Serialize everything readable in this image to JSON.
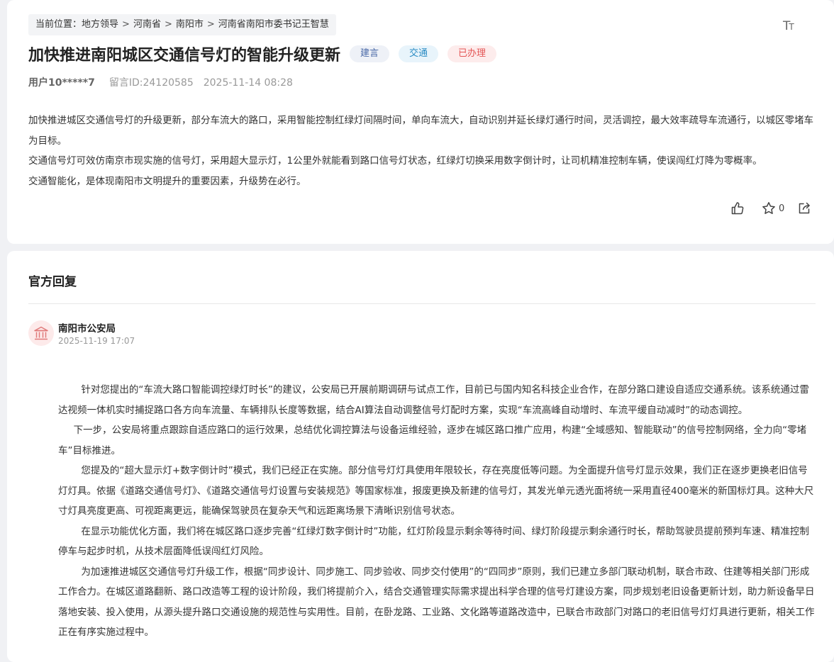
{
  "breadcrumb": {
    "prefix": "当前位置：",
    "items": [
      "地方领导",
      "河南省",
      "南阳市",
      "河南省南阳市委书记王智慧"
    ],
    "separator": ">"
  },
  "font_size_button": {
    "label": "T",
    "label_small": "T"
  },
  "message": {
    "title": "加快推进南阳城区交通信号灯的智能升级更新",
    "tags": [
      "建言",
      "交通",
      "已办理"
    ],
    "user": "用户10*****7",
    "message_id": "留言ID:24120585",
    "datetime": "2025-11-14 08:28",
    "paragraphs": [
      "加快推进城区交通信号灯的升级更新，部分车流大的路口，采用智能控制红绿灯间隔时间，单向车流大，自动识别并延长绿灯通行时间，灵活调控，最大效率疏导车流通行，以城区零堵车为目标。",
      "交通信号灯可效仿南京市现实施的信号灯，采用超大显示灯，1公里外就能看到路口信号灯状态，红绿灯切换采用数字倒计时，让司机精准控制车辆，使误闯红灯降为零概率。",
      "交通智能化，是体现南阳市文明提升的重要因素，升级势在必行。"
    ],
    "favorite_count": "0"
  },
  "icons": {
    "like": "thumbs-up-icon",
    "favorite": "star-icon",
    "share": "share-icon",
    "department": "government-building-icon"
  },
  "colors": {
    "tag_done": "#e45656",
    "tag_traffic": "#2b8cc4",
    "tag_suggest": "#4b6aa8",
    "avatar_icon": "#e07a7a"
  },
  "reply": {
    "heading": "官方回复",
    "department": "南阳市公安局",
    "datetime": "2025-11-19 17:07",
    "paragraphs": [
      "针对您提出的“车流大路口智能调控绿灯时长”的建议，公安局已开展前期调研与试点工作，目前已与国内知名科技企业合作，在部分路口建设自适应交通系统。该系统通过雷达视频一体机实时捕捉路口各方向车流量、车辆排队长度等数据，结合AI算法自动调整信号灯配时方案，实现“车流高峰自动增时、车流平缓自动减时”的动态调控。",
      "下一步，公安局将重点跟踪自适应路口的运行效果，总结优化调控算法与设备运维经验，逐步在城区路口推广应用，构建“全域感知、智能联动”的信号控制网络，全力向“零堵车”目标推进。",
      "您提及的“超大显示灯+数字倒计时”模式，我们已经正在实施。部分信号灯灯具使用年限较长，存在亮度低等问题。为全面提升信号灯显示效果，我们正在逐步更换老旧信号灯灯具。依据《道路交通信号灯》、《道路交通信号灯设置与安装规范》等国家标准，报废更换及新建的信号灯，其发光单元透光面将统一采用直径400毫米的新国标灯具。这种大尺寸灯具亮度更高、可视距离更远，能确保驾驶员在复杂天气和远距离场景下清晰识别信号状态。",
      "在显示功能优化方面，我们将在城区路口逐步完善“红绿灯数字倒计时”功能，红灯阶段显示剩余等待时间、绿灯阶段提示剩余通行时长，帮助驾驶员提前预判车速、精准控制停车与起步时机，从技术层面降低误闯红灯风险。",
      "为加速推进城区交通信号灯升级工作，根据“同步设计、同步施工、同步验收、同步交付使用”的“四同步”原则，我们已建立多部门联动机制，联合市政、住建等相关部门形成工作合力。在城区道路翻新、路口改造等工程的设计阶段，我们将提前介入，结合交通管理实际需求提出科学合理的信号灯建设方案，同步规划老旧设备更新计划，助力新设备早日落地安装、投入使用，从源头提升路口交通设施的规范性与实用性。目前，在卧龙路、工业路、文化路等道路改造中，已联合市政部门对路口的老旧信号灯灯具进行更新，相关工作正在有序实施过程中。"
    ]
  }
}
